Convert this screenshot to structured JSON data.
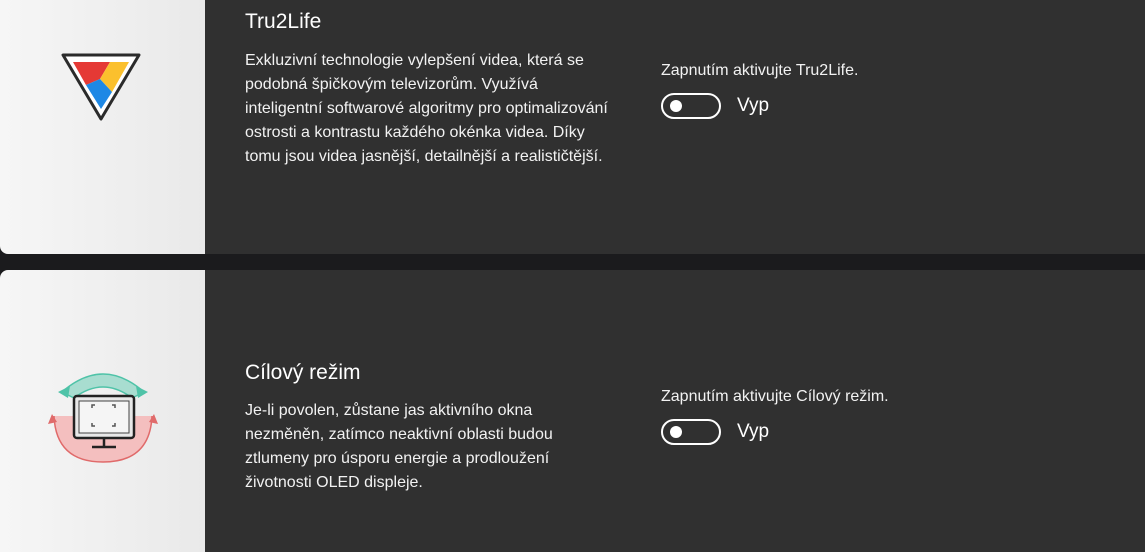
{
  "tru2life": {
    "title": "Tru2Life",
    "description": "Exkluzivní technologie vylepšení videa, která se podobná špičkovým televizorům. Využívá inteligentní softwarové algoritmy pro optimalizování ostrosti a kontrastu každého okénka videa. Díky tomu jsou videa jasnější, detailnější a realističtější.",
    "setting_label": "Zapnutím aktivujte Tru2Life.",
    "toggle_state": "Vyp",
    "icon": "tru2life-logo-icon"
  },
  "target_mode": {
    "title": "Cílový režim",
    "description": "Je-li povolen, zůstane jas aktivního okna nezměněn, zatímco neaktivní oblasti budou ztlumeny pro úsporu energie a prodloužení životnosti OLED displeje.",
    "setting_label": "Zapnutím aktivujte Cílový režim.",
    "toggle_state": "Vyp",
    "icon": "target-mode-monitor-icon"
  },
  "colors": {
    "background": "#1b1b1d",
    "card": "#303030",
    "icon_panel": "#efefef",
    "text": "#ffffff",
    "teal_accent": "#4fc3a8",
    "red_accent": "#e06a6a"
  }
}
